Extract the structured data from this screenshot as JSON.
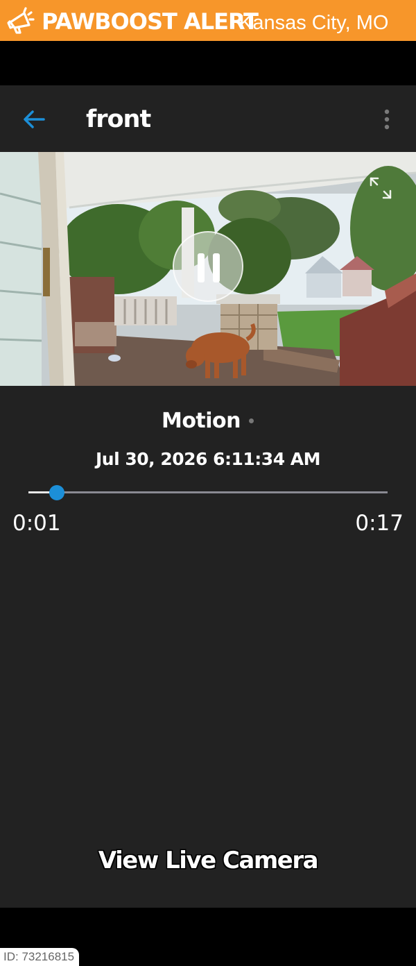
{
  "banner": {
    "title": "PAWBOOST ALERT",
    "location": "Kansas City, MO",
    "icon": "megaphone-icon",
    "color": "#f7962a"
  },
  "header": {
    "title": "front",
    "back_icon": "arrow-left-icon",
    "more_icon": "more-vertical-icon",
    "accent": "#1c8fd8"
  },
  "video": {
    "state": "playing",
    "control_icon": "pause-icon",
    "fullscreen_icon": "expand-icon"
  },
  "event": {
    "type": "Motion",
    "timestamp": "Jul 30, 2026 6:11:34 AM"
  },
  "playback": {
    "current": "0:01",
    "total": "0:17",
    "progress": 0.08
  },
  "live_button": "View Live Camera",
  "id_tag": "ID: 73216815"
}
